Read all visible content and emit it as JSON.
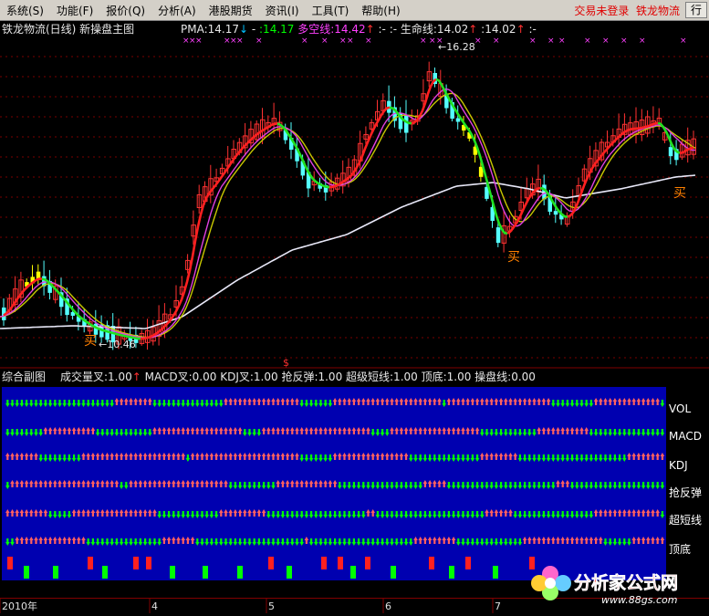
{
  "menu": {
    "items": [
      "系统(S)",
      "功能(F)",
      "报价(Q)",
      "分析(A)",
      "港股期货",
      "资讯(I)",
      "工具(T)",
      "帮助(H)"
    ],
    "status_text": "交易未登录",
    "stock_name": "铁龙物流",
    "right_button": "行"
  },
  "main_chart": {
    "title": "铁龙物流(日线) 新操盘主图",
    "indicators": [
      {
        "label": "PMA:14.17",
        "color": "#e8e8e8",
        "arrow": "↓",
        "arrow_color": "#00c0ff"
      },
      {
        "label": "-",
        "color": "#e8e8e8"
      },
      {
        "label": ":14.17",
        "color": "#00ff00"
      },
      {
        "label": "多空线:14.42",
        "color": "#ff40ff",
        "arrow": "↑",
        "arrow_color": "#ff3030"
      },
      {
        "label": ":-",
        "color": "#e8e8e8"
      },
      {
        "label": ":-",
        "color": "#e8e8e8"
      },
      {
        "label": "生命线:14.02",
        "color": "#e8e8e8",
        "arrow": "↑",
        "arrow_color": "#ff3030"
      },
      {
        "label": ":14.02",
        "color": "#e8e8e8",
        "arrow": "↑",
        "arrow_color": "#ff3030"
      },
      {
        "label": ":-",
        "color": "#e8e8e8"
      }
    ],
    "high_label": "16.28",
    "low_label": "10.46",
    "buy_signal": "买",
    "buy_labels": [
      "买",
      "买",
      "买"
    ],
    "divider_mark": "$"
  },
  "sub_chart": {
    "title": "综合副图",
    "indicators": [
      {
        "label": "成交量叉:1.00",
        "arrow": "↑"
      },
      {
        "label": "MACD叉:0.00"
      },
      {
        "label": "KDJ叉:1.00"
      },
      {
        "label": "抢反弹:1.00"
      },
      {
        "label": "超级短线:1.00"
      },
      {
        "label": "顶底:1.00"
      },
      {
        "label": "操盘线:0.00"
      }
    ],
    "rows": [
      "VOL",
      "MACD",
      "KDJ",
      "抢反弹",
      "超短线",
      "顶底"
    ]
  },
  "time_axis": {
    "labels": [
      "2010年",
      "4",
      "5",
      "6",
      "7"
    ]
  },
  "logo": {
    "text": "分析家公式网",
    "url": "www.88gs.com"
  },
  "colors": {
    "up": "#ff3232",
    "down": "#54ffff",
    "yellow": "#ffff00",
    "white_line": "#e8e8f8",
    "magenta_line": "#e040e0",
    "panel_blue": "#0000b0"
  }
}
